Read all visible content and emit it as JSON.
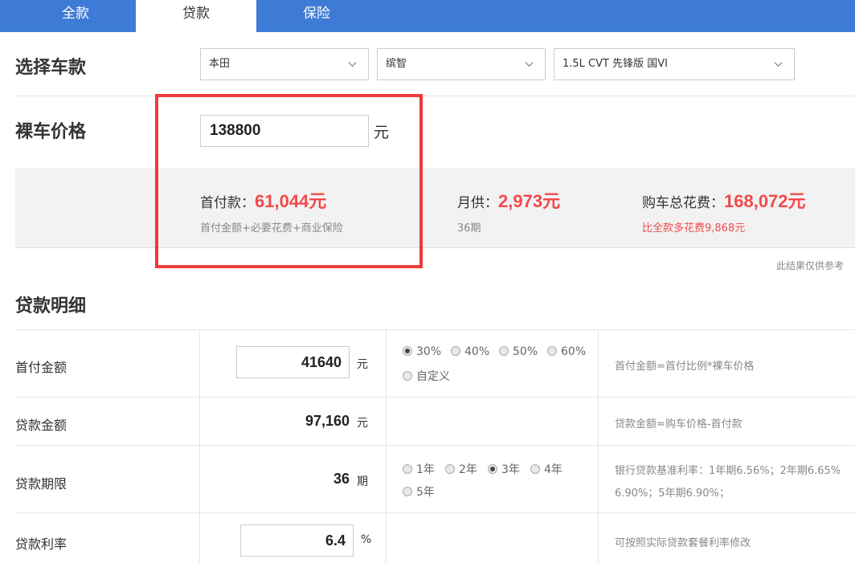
{
  "tabs": [
    {
      "label": "全款"
    },
    {
      "label": "贷款"
    },
    {
      "label": "保险"
    }
  ],
  "select_car": {
    "title": "选择车款",
    "brand": "本田",
    "series": "缤智",
    "model": "1.5L CVT 先锋版 国VI"
  },
  "price": {
    "title": "裸车价格",
    "value": "138800",
    "unit": "元"
  },
  "summary": {
    "down_label": "首付款：",
    "down_value": "61,044",
    "down_unit": "元",
    "down_sub": "首付金额+必要花费+商业保险",
    "monthly_label": "月供：",
    "monthly_value": "2,973",
    "monthly_unit": "元",
    "monthly_sub": "36期",
    "total_label": "购车总花费：",
    "total_value": "168,072",
    "total_unit": "元",
    "total_sub": "比全款多花费9,868元"
  },
  "note": "此结果仅供参考",
  "detail": {
    "title": "贷款明细",
    "down_payment": {
      "label": "首付金额",
      "value": "41640",
      "unit": "元",
      "options": [
        "30%",
        "40%",
        "50%",
        "60%",
        "自定义"
      ],
      "selected": "30%",
      "hint": "首付金额=首付比例*裸车价格"
    },
    "loan_amount": {
      "label": "贷款金额",
      "value": "97,160",
      "unit": "元",
      "hint": "贷款金额=购车价格-首付款"
    },
    "term": {
      "label": "贷款期限",
      "value": "36",
      "unit": "期",
      "options": [
        "1年",
        "2年",
        "3年",
        "4年",
        "5年"
      ],
      "selected": "3年",
      "hint_line1": "银行贷款基准利率：1年期6.56%；2年期6.65%",
      "hint_line2": "6.90%；5年期6.90%；"
    },
    "rate": {
      "label": "贷款利率",
      "value": "6.4",
      "unit": "%",
      "hint": "可按照实际贷款套餐利率修改"
    }
  }
}
